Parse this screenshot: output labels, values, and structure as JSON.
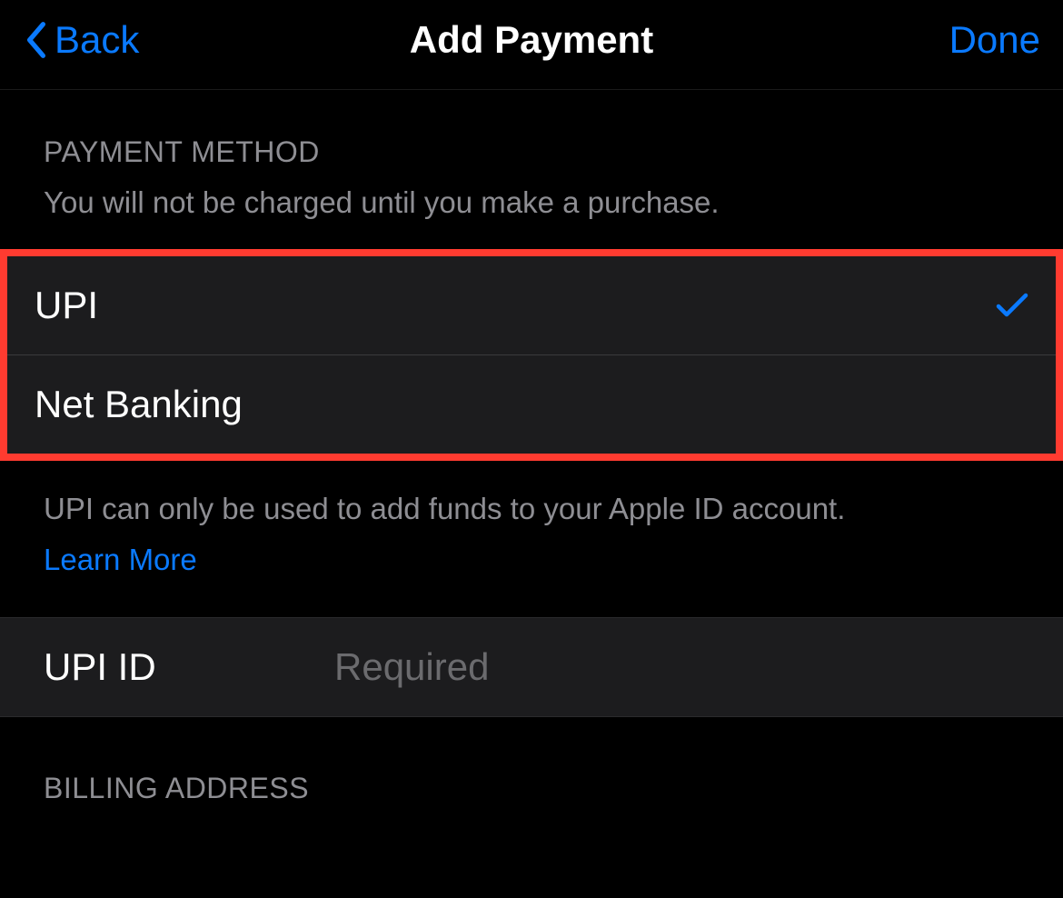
{
  "nav": {
    "back_label": "Back",
    "title": "Add Payment",
    "done_label": "Done"
  },
  "payment_method": {
    "header": "PAYMENT METHOD",
    "subtext": "You will not be charged until you make a purchase.",
    "options": [
      {
        "label": "UPI",
        "selected": true
      },
      {
        "label": "Net Banking",
        "selected": false
      }
    ],
    "footer_text": "UPI can only be used to add funds to your Apple ID account.",
    "learn_more_label": "Learn More"
  },
  "upi_field": {
    "label": "UPI ID",
    "placeholder": "Required",
    "value": ""
  },
  "billing": {
    "header": "BILLING ADDRESS"
  }
}
